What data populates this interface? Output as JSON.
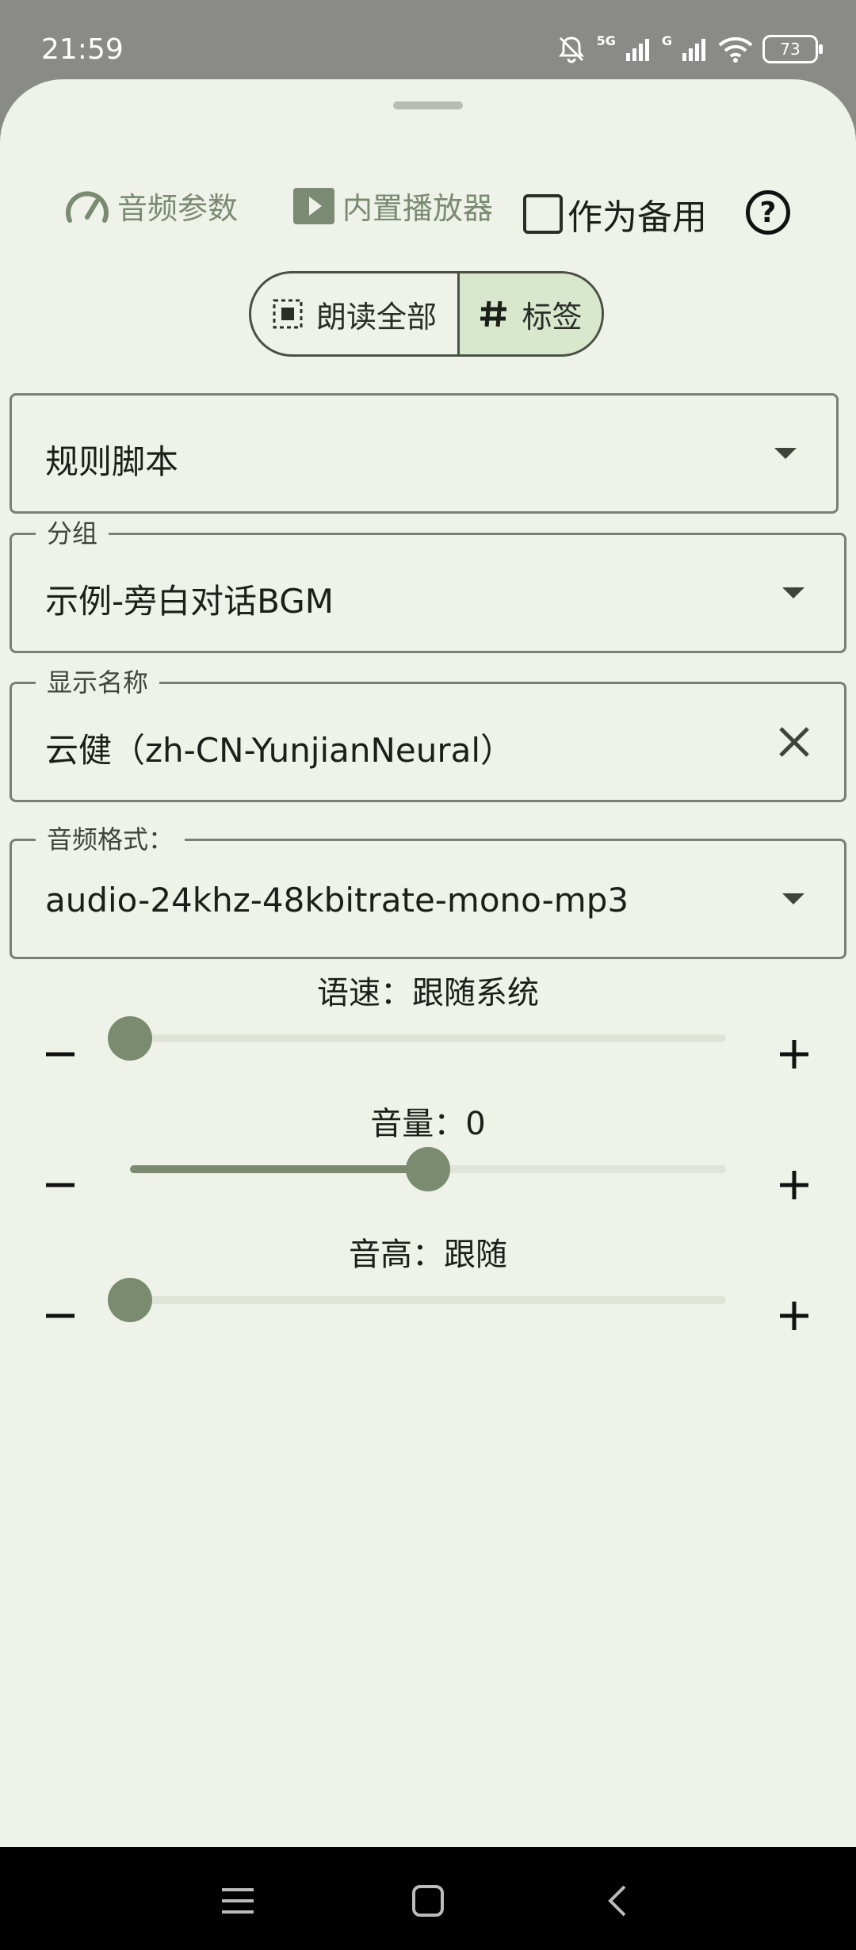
{
  "status_bar": {
    "time": "21:59",
    "battery": "73",
    "network_labels": [
      "5G",
      "G"
    ]
  },
  "toolbar": {
    "audio_params_label": "音频参数",
    "builtin_player_label": "内置播放器",
    "backup_label": "作为备用",
    "backup_checked": false,
    "help_label": "?"
  },
  "segmented": {
    "read_all_label": "朗读全部",
    "tag_label": "标签",
    "selected": "tag"
  },
  "fields": {
    "rule_script": {
      "value": "规则脚本"
    },
    "group": {
      "label": "分组",
      "value": "示例-旁白对话BGM"
    },
    "display_name": {
      "label": "显示名称",
      "value": "云健（zh-CN-YunjianNeural）"
    },
    "audio_format": {
      "label": "音频格式：",
      "value": "audio-24khz-48kbitrate-mono-mp3"
    }
  },
  "sliders": {
    "speed": {
      "title": "语速：跟随系统",
      "fraction": 0.0
    },
    "volume": {
      "title": "音量：0",
      "fraction": 0.5
    },
    "pitch": {
      "title": "音高：跟随",
      "fraction": 0.0
    }
  },
  "colors": {
    "accent": "#7a8b6f",
    "sheet_background": "#eff2e8",
    "segment_selected": "#d9e7cd"
  }
}
